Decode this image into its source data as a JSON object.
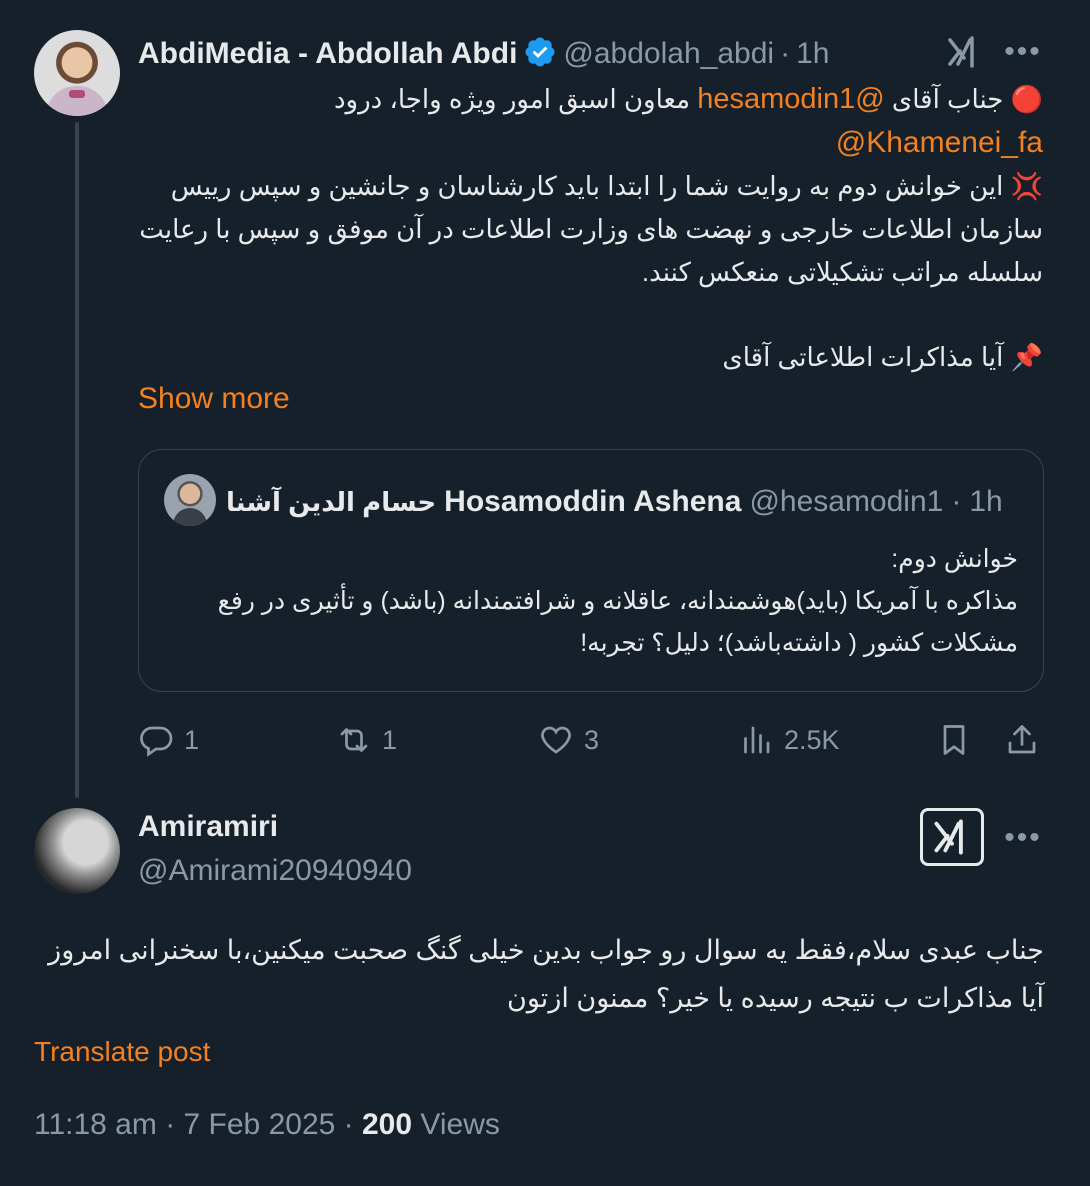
{
  "tweet1": {
    "display_name": "AbdiMedia - Abdollah Abdi",
    "handle": "@abdolah_abdi",
    "time": "1h",
    "line1_text": "جناب آقای ",
    "line1_mention": "@hesamodin1",
    "line1_rest": " معاون اسبق امور ویژه واجا، درود",
    "line2_mention": "@Khamenei_fa",
    "para": "این خوانش دوم به روایت شما را ابتدا باید کارشناسان و جانشین و سپس رییس سازمان اطلاعات خارجی و نهضت های وزارت اطلاعات در آن موفق و سپس با رعایت سلسله مراتب تشکیلاتی منعکس کنند.",
    "question": "آیا مذاکرات اطلاعاتی آقای",
    "show_more": "Show more",
    "emoji_red": "🔴",
    "emoji_anger": "💢",
    "emoji_pin": "📌"
  },
  "quote": {
    "name_fa": "حسام الدین آشنا",
    "name_en": "Hosamoddin Ashena",
    "handle": "@hesamodin1",
    "time": "1h",
    "text": "خوانش دوم:\nمذاکره با آمریکا (باید)هوشمندانه، عاقلانه و شرافتمندانه (باشد) و  تأثیری در رفع مشکلات کشور ( داشته‌باشد)؛ دلیل؟ تجربه!"
  },
  "actions": {
    "replies": "1",
    "reposts": "1",
    "likes": "3",
    "views": "2.5K"
  },
  "tweet2": {
    "display_name": "Amiramiri",
    "handle": "@Amirami20940940",
    "text": "جناب عبدی سلام،فقط یه سوال رو جواب بدین خیلی گنگ صحبت میکنین،با سخنرانی امروز آیا مذاکرات ب نتیجه رسیده یا خیر؟ ممنون ازتون",
    "translate": "Translate post",
    "time": "11:18 am",
    "date": "7 Feb 2025",
    "views_count": "200",
    "views_label": "Views"
  },
  "colors": {
    "background": "#15202b",
    "accent_orange": "#f4811f",
    "muted": "#8b98a5",
    "verified_blue": "#1d9bf0"
  }
}
